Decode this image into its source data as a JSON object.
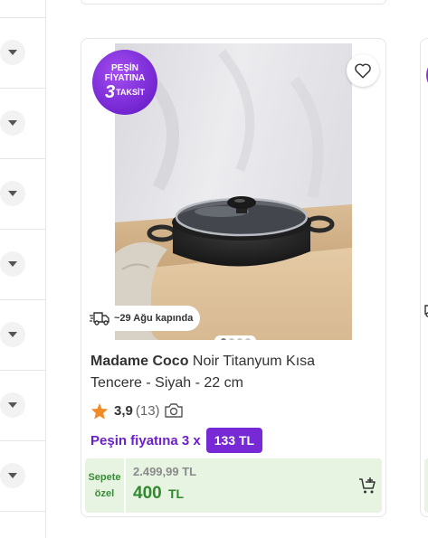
{
  "filters": {
    "rows": [
      "chevron-down",
      "chevron-down",
      "chevron-down",
      "chevron-down",
      "chevron-down",
      "chevron-down",
      "chevron-down"
    ]
  },
  "product": {
    "campaign_badge": {
      "line1": "PEŞİN",
      "line2": "FİYATINA",
      "number": "3",
      "word": "TAKSİT"
    },
    "delivery": "~29 Ağu kapında",
    "brand": "Madame Coco",
    "name": " Noir Titanyum Kısa Tencere - Siyah - 22 cm",
    "rating": "3,9",
    "review_count": "(13)",
    "installment_text": "Peşin fiyatına 3 x",
    "installment_amount": "133 TL",
    "price_label_line1": "Sepete",
    "price_label_line2": "özel",
    "old_price": "2.499,99 TL",
    "new_price": "400",
    "new_price_currency": "TL",
    "image_count": 4,
    "active_image": 1
  },
  "colors": {
    "accent_purple": "#7629d4",
    "price_green": "#2f8a2f",
    "price_bg": "#e6f4e1",
    "star": "#f28b27"
  }
}
